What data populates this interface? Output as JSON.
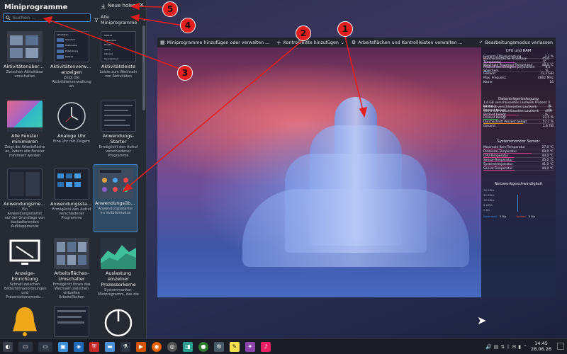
{
  "explorer": {
    "title": "Miniprogramme",
    "get_new": "Neue holen ...",
    "search_placeholder": "Suchen ...",
    "filter_label": "Alle Miniprogramme",
    "tiles": [
      {
        "name": "Aktivitätenübersi...",
        "desc": "Zwischen Aktivitäten umschalten"
      },
      {
        "name": "Aktivitätenverwaltung anzeigen",
        "desc": "Zeigt die Aktivitätenverwaltung an"
      },
      {
        "name": "Aktivitätsleiste",
        "desc": "Leiste zum Wechseln von Aktivitäten"
      },
      {
        "name": "Alle Fenster minimieren",
        "desc": "Zeigt die Arbeitsfläche an, indem alle Fenster minimiert werden"
      },
      {
        "name": "Analoge Uhr",
        "desc": "Eine Uhr mit Zeigern"
      },
      {
        "name": "Anwendungs-Starter",
        "desc": "Ermöglicht den Aufruf verschiedener Programme"
      },
      {
        "name": "Anwendungsmenü",
        "desc": "Ein Anwendungsstarter auf der Grundlage von kaskadierenden Aufklappmenüs"
      },
      {
        "name": "Anwendungsstart...",
        "desc": "Ermöglicht den Aufruf verschiedener Programme"
      },
      {
        "name": "Anwendungsüber...",
        "desc": "Anwendungsstarter im Vollbildmodus"
      },
      {
        "name": "Anzeige-Einrichtung",
        "desc": "Schnell zwischen Bildschirmanordnungen und Präsentationsmodu..."
      },
      {
        "name": "Arbeitsflächen-Umschalter",
        "desc": "Ermöglicht Ihnen das Wechseln zwischen virtuellen Arbeitsflächen"
      },
      {
        "name": "Auslastung einzelner Prozessorkerne",
        "desc": "Systemmonitor-Miniprogramm, das die ..."
      },
      {
        "name": "",
        "desc": ""
      },
      {
        "name": "",
        "desc": ""
      },
      {
        "name": "",
        "desc": ""
      }
    ],
    "activities_list": [
      "Aktivitäten",
      "Standard",
      "Multimedia",
      "Entwicklung",
      "Default"
    ],
    "activities_bar": [
      "Default",
      "Multimedia",
      "Private",
      "Office",
      "Internet",
      "Development"
    ]
  },
  "toolbar": {
    "add_widgets": "Miniprogramme hinzufügen oder verwalten ...",
    "add_panel": "Kontrollleiste hinzufügen",
    "configure": "Arbeitsflächen und Kontrollleisten verwalten ...",
    "exit_edit": "Bearbeitungsmodus verlassen"
  },
  "sysmon": {
    "cpu_ram_title": "CPU und RAM",
    "cpu_ram_rows": [
      {
        "label": "Gesamt-CPU-Auslastung",
        "value": "2,2 %",
        "fill": 0.02,
        "color": "#e8533a"
      },
      {
        "label": "Durchschnittliche Prozessor-Temperatur",
        "value": "45,0 °C",
        "fill": 0.45,
        "color": "#c24bc4"
      },
      {
        "label": "Maximale Prozessor-Temperatur",
        "value": "48,0 °C",
        "fill": 0.48,
        "color": "#c24bc4"
      },
      {
        "label": "Prozent des belegten physischen Speichers",
        "value": "8,1 %",
        "fill": 0.08,
        "color": "#3a8ee8"
      },
      {
        "label": "Gesamt",
        "value": "12,3 GiB",
        "fill": 0,
        "color": ""
      },
      {
        "label": "Max. Frequenz",
        "value": "4802 MHz",
        "fill": 0,
        "color": ""
      },
      {
        "label": "Kerne",
        "value": "16",
        "fill": 0,
        "color": ""
      }
    ],
    "storage_title": "Datenträgerbelegung",
    "storage_rows": [
      {
        "label": "1,0 GB verschlüsseltes Laufwerk Prozent belegt",
        "value": "0 %",
        "fill": 0.0,
        "color": "#e05a2c"
      },
      {
        "label": "64,4 GiB verschlüsseltes Laufwerk Prozent belegt",
        "value": "0 %",
        "fill": 0.0,
        "color": "#e05a2c"
      },
      {
        "label": "986,5 GiB verschlüsseltes Laufwerk Prozent belegt",
        "value": "49,9 %",
        "fill": 0.5,
        "color": "#d73c8a"
      },
      {
        "label": "Prozent belegt",
        "value": "21,5 %",
        "fill": 0.21,
        "color": "#2fb34a"
      },
      {
        "label": "Durchschnitt Prozent belegt",
        "value": "57,1 %",
        "fill": 0.57,
        "color": "#e68d22"
      },
      {
        "label": "Gesamt",
        "value": "1,8 TiB",
        "fill": 0,
        "color": ""
      }
    ],
    "sensors_title": "Systemmonitor Sensor",
    "sensors_rows": [
      {
        "label": "Maximale Kern-Temperatur",
        "value": "27,0 °C",
        "fill": 0.27,
        "color": "#d73c8a"
      },
      {
        "label": "Prozessor-Temperatur",
        "value": "69,0 °C",
        "fill": 0.69,
        "color": "#d73c8a"
      },
      {
        "label": "CPU-Temperatur",
        "value": "44,0 °C",
        "fill": 0.44,
        "color": "#d73c8a"
      },
      {
        "label": "Sensor-Temperatur",
        "value": "45,0 °C",
        "fill": 0.45,
        "color": "#d73c8a"
      },
      {
        "label": "Systemtemperatur",
        "value": "41,0 °C",
        "fill": 0.41,
        "color": "#d73c8a"
      },
      {
        "label": "Sensor-Temperatur",
        "value": "44,0 °C",
        "fill": 0.44,
        "color": "#d73c8a"
      }
    ],
    "network_title": "Netzwerkgeschwindigkeit",
    "network_ticks": [
      "36 KiB/s",
      "24 KiB/s",
      "16 KiB/s",
      "8 KiB/s",
      "0 B/s"
    ],
    "network_legend": [
      "Download",
      "0 B/s",
      "Upload",
      "0 B/s"
    ]
  },
  "markers": [
    "1",
    "2",
    "3",
    "4",
    "5"
  ],
  "clock": {
    "time": "14:45",
    "date": "28.06.26"
  }
}
